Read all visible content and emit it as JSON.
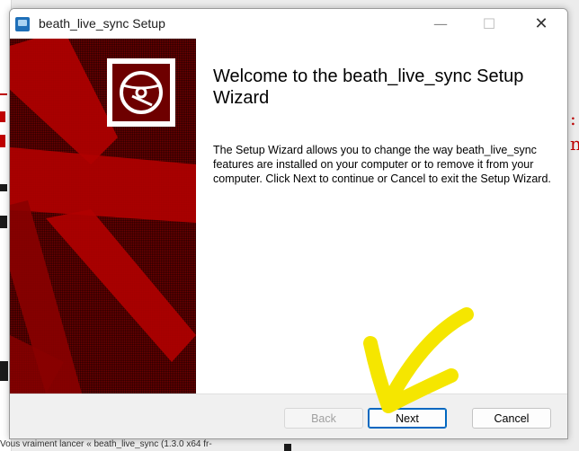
{
  "window": {
    "title": "beath_live_sync Setup",
    "minimize_glyph": "—",
    "maximize_glyph": "☐",
    "close_glyph": "✕"
  },
  "content": {
    "heading": "Welcome to the beath_live_sync Setup Wizard",
    "body": "The Setup Wizard allows you to change the way beath_live_sync features are installed on your computer or to remove it from your computer. Click Next to continue or Cancel to exit the Setup Wizard."
  },
  "buttons": {
    "back": "Back",
    "next": "Next",
    "cancel": "Cancel"
  },
  "background": {
    "bottom_text": "Vous vraiment lancer « beath_live_sync (1.3.0 x64 fr-",
    "right_text": ":\nne"
  },
  "icons": {
    "app": "installer-icon",
    "banner_logo": "disc-icon"
  },
  "colors": {
    "banner": "#6e0000",
    "next_button_border": "#0067c0",
    "annotation_arrow": "#f5e600"
  }
}
